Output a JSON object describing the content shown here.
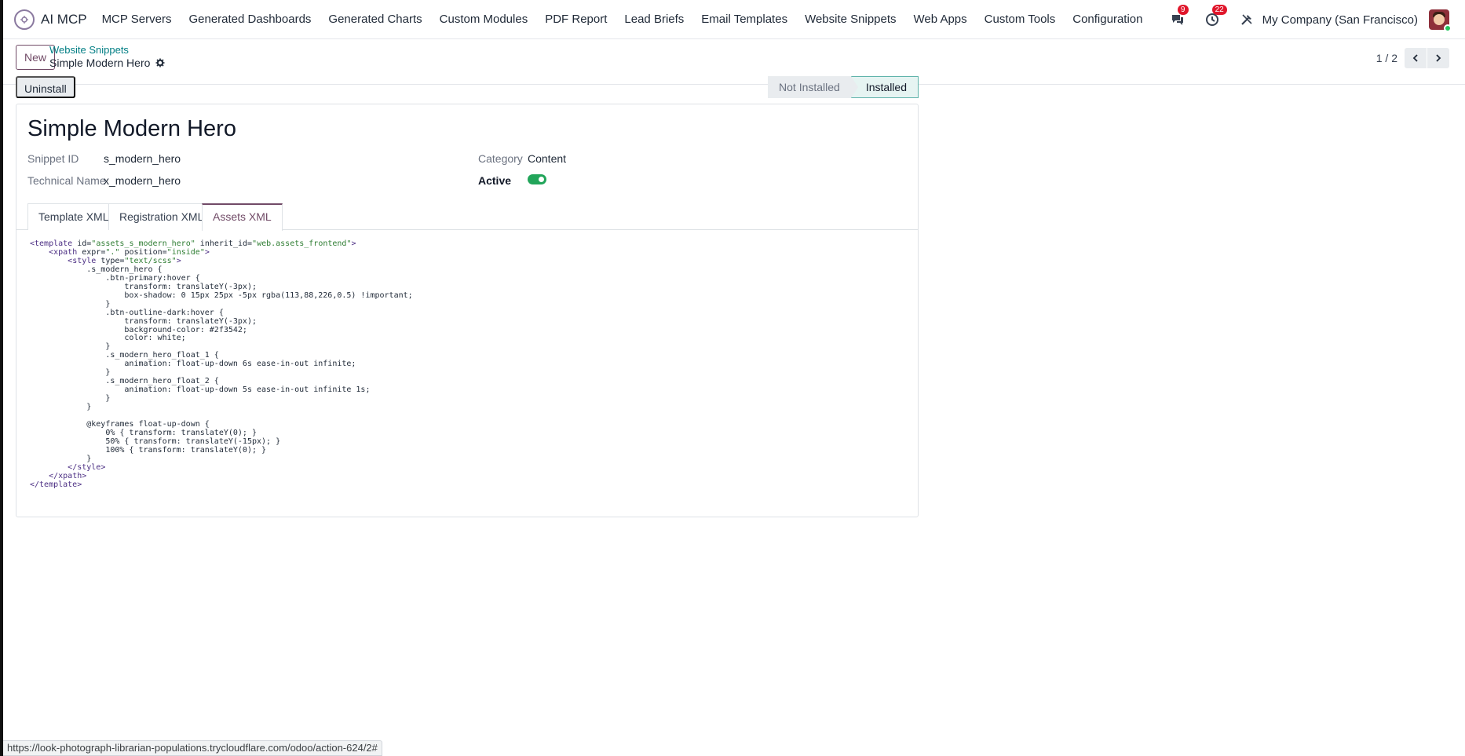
{
  "app": {
    "name": "AI MCP",
    "menu": [
      "MCP Servers",
      "Generated Dashboards",
      "Generated Charts",
      "Custom Modules",
      "PDF Report",
      "Lead Briefs",
      "Email Templates",
      "Website Snippets",
      "Web Apps",
      "Custom Tools",
      "Configuration"
    ],
    "messages_count": "9",
    "activities_count": "22",
    "company": "My Company (San Francisco)",
    "icons": {
      "brand": "ai-mcp-logo-icon",
      "messages": "chat-bubbles-icon",
      "activities": "clock-icon",
      "debug": "tools-icon",
      "user": "user-avatar"
    }
  },
  "control": {
    "new_label": "New",
    "breadcrumb": "Website Snippets",
    "record_name": "Simple Modern Hero",
    "pager": "1 / 2"
  },
  "status": {
    "uninstall_label": "Uninstall",
    "stages": [
      "Not Installed",
      "Installed"
    ],
    "current_stage": "Installed"
  },
  "form": {
    "title": "Simple Modern Hero",
    "snippet_id_label": "Snippet ID",
    "snippet_id": "s_modern_hero",
    "technical_name_label": "Technical Name",
    "technical_name": "x_modern_hero",
    "category_label": "Category",
    "category": "Content",
    "active_label": "Active",
    "active": true
  },
  "tabs": [
    "Template XML",
    "Registration XML",
    "Assets XML"
  ],
  "active_tab": "Assets XML",
  "code": {
    "template_id": "assets_s_modern_hero",
    "inherit_id": "web.assets_frontend",
    "xpath_expr": ".",
    "xpath_position": "inside",
    "style_type": "text/scss",
    "css_lines": [
      "            .s_modern_hero {",
      "                .btn-primary:hover {",
      "                    transform: translateY(-3px);",
      "                    box-shadow: 0 15px 25px -5px rgba(113,88,226,0.5) !important;",
      "                }",
      "                .btn-outline-dark:hover {",
      "                    transform: translateY(-3px);",
      "                    background-color: #2f3542;",
      "                    color: white;",
      "                }",
      "                .s_modern_hero_float_1 {",
      "                    animation: float-up-down 6s ease-in-out infinite;",
      "                }",
      "                .s_modern_hero_float_2 {",
      "                    animation: float-up-down 5s ease-in-out infinite 1s;",
      "                }",
      "            }",
      "",
      "            @keyframes float-up-down {",
      "                0% { transform: translateY(0); }",
      "                50% { transform: translateY(-15px); }",
      "                100% { transform: translateY(0); }",
      "            }"
    ]
  },
  "url_status": "https://look-photograph-librarian-populations.trycloudflare.com/odoo/action-624/2#"
}
